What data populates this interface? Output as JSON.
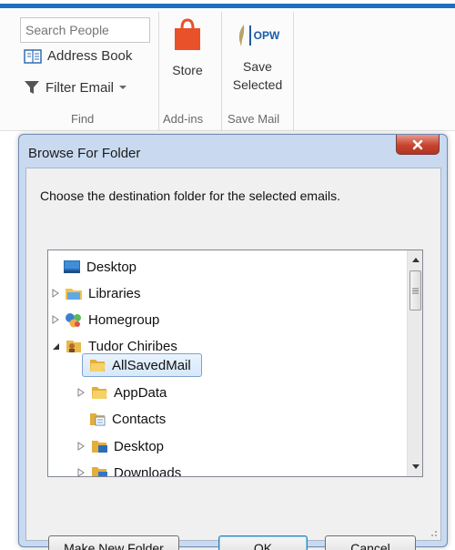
{
  "ribbon": {
    "search_placeholder": "Search People",
    "address_book_label": "Address Book",
    "filter_email_label": "Filter Email",
    "find_group_label": "Find",
    "store_label": "Store",
    "addins_group_label": "Add-ins",
    "save_selected_label_line1": "Save",
    "save_selected_label_line2": "Selected",
    "save_mail_group_label": "Save Mail",
    "opw_badge": "OPW"
  },
  "dialog": {
    "title": "Browse For Folder",
    "prompt": "Choose the destination folder for the selected emails.",
    "tree": [
      {
        "label": "Desktop",
        "icon": "desktop-icon",
        "expander": "none",
        "level": 0
      },
      {
        "label": "Libraries",
        "icon": "libraries-icon",
        "expander": "collapsed",
        "level": 0
      },
      {
        "label": "Homegroup",
        "icon": "homegroup-icon",
        "expander": "collapsed",
        "level": 0
      },
      {
        "label": "Tudor Chiribes",
        "icon": "user-folder-icon",
        "expander": "expanded",
        "level": 0
      },
      {
        "label": "AllSavedMail",
        "icon": "folder-icon",
        "expander": "none",
        "level": 1,
        "selected": true
      },
      {
        "label": "AppData",
        "icon": "folder-icon",
        "expander": "collapsed",
        "level": 1
      },
      {
        "label": "Contacts",
        "icon": "contacts-folder-icon",
        "expander": "none",
        "level": 1
      },
      {
        "label": "Desktop",
        "icon": "desktop-folder-icon",
        "expander": "collapsed",
        "level": 1
      },
      {
        "label": "Downloads",
        "icon": "downloads-folder-icon",
        "expander": "collapsed",
        "level": 1
      }
    ],
    "buttons": {
      "make_new_folder": "Make New Folder",
      "ok": "OK",
      "cancel": "Cancel"
    }
  },
  "colors": {
    "accent": "#1f6fbf",
    "selection": "#cce4f7",
    "dialog_frame": "#c9daf0",
    "close_button": "#c7432f"
  }
}
